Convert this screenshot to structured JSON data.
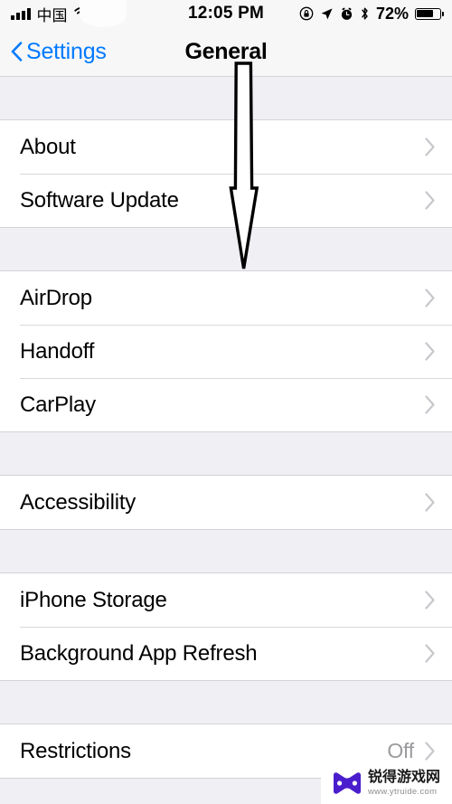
{
  "status_bar": {
    "carrier": "中国",
    "signal_icon": "signal-bars-icon",
    "wifi_icon": "wifi-icon",
    "time": "12:05 PM",
    "rotation_lock_icon": "rotation-lock-icon",
    "location_icon": "location-arrow-icon",
    "alarm_icon": "alarm-clock-icon",
    "bluetooth_icon": "bluetooth-icon",
    "battery_percent": "72%",
    "battery_level": 72
  },
  "nav_bar": {
    "back_label": "Settings",
    "back_icon": "chevron-left-icon",
    "title": "General",
    "accent_color": "#007aff"
  },
  "sections": [
    {
      "rows": [
        {
          "label": "About",
          "value": "",
          "accessory": "disclosure-chevron-icon"
        },
        {
          "label": "Software Update",
          "value": "",
          "accessory": "disclosure-chevron-icon"
        }
      ]
    },
    {
      "rows": [
        {
          "label": "AirDrop",
          "value": "",
          "accessory": "disclosure-chevron-icon"
        },
        {
          "label": "Handoff",
          "value": "",
          "accessory": "disclosure-chevron-icon"
        },
        {
          "label": "CarPlay",
          "value": "",
          "accessory": "disclosure-chevron-icon"
        }
      ]
    },
    {
      "rows": [
        {
          "label": "Accessibility",
          "value": "",
          "accessory": "disclosure-chevron-icon"
        }
      ]
    },
    {
      "rows": [
        {
          "label": "iPhone Storage",
          "value": "",
          "accessory": "disclosure-chevron-icon"
        },
        {
          "label": "Background App Refresh",
          "value": "",
          "accessory": "disclosure-chevron-icon"
        }
      ]
    },
    {
      "rows": [
        {
          "label": "Restrictions",
          "value": "Off",
          "accessory": "disclosure-chevron-icon"
        }
      ]
    }
  ],
  "annotation": {
    "arrow_icon": "down-arrow-annotation",
    "color": "#000000"
  },
  "watermark": {
    "icon": "gamepad-icon",
    "brand": "锐得游戏网",
    "url": "www.ytruide.com",
    "brand_color": "#4b1ecd"
  }
}
